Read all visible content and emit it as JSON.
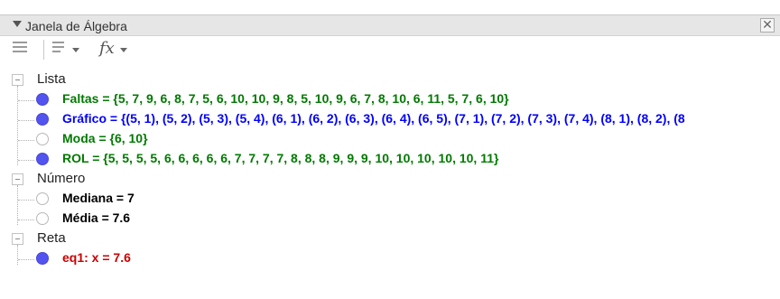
{
  "window": {
    "title": "Janela de Álgebra",
    "close_glyph": "✕"
  },
  "toolbar": {
    "icons": [
      "auxiliary-objects-icon",
      "sort-icon",
      "fx-icon"
    ],
    "fx_label": "fx"
  },
  "categories": [
    {
      "label": "Lista",
      "items": [
        {
          "text": "Faltas = {5, 7, 9, 6, 8, 7, 5, 6, 10, 10, 9, 8, 5, 10, 9, 6, 7, 8, 10, 6, 11, 5, 7, 6, 10}",
          "visible": true,
          "color": "#007a00"
        },
        {
          "text": "Gráfico = {(5, 1), (5, 2), (5, 3), (5, 4), (6, 1), (6, 2), (6, 3), (6, 4), (6, 5), (7, 1), (7, 2), (7, 3), (7, 4), (8, 1), (8, 2), (8",
          "visible": true,
          "color": "#0000ff"
        },
        {
          "text": "Moda = {6, 10}",
          "visible": false,
          "color": "#007a00"
        },
        {
          "text": "ROL = {5, 5, 5, 5, 6, 6, 6, 6, 6, 7, 7, 7, 7, 8, 8, 8, 9, 9, 9, 10, 10, 10, 10, 10, 11}",
          "visible": true,
          "color": "#007a00"
        }
      ]
    },
    {
      "label": "Número",
      "items": [
        {
          "text": "Mediana = 7",
          "visible": false,
          "color": "#000000"
        },
        {
          "text": "Média = 7.6",
          "visible": false,
          "color": "#000000"
        }
      ]
    },
    {
      "label": "Reta",
      "items": [
        {
          "text": "eq1: x = 7.6",
          "visible": true,
          "color": "#cc0000"
        }
      ]
    }
  ]
}
